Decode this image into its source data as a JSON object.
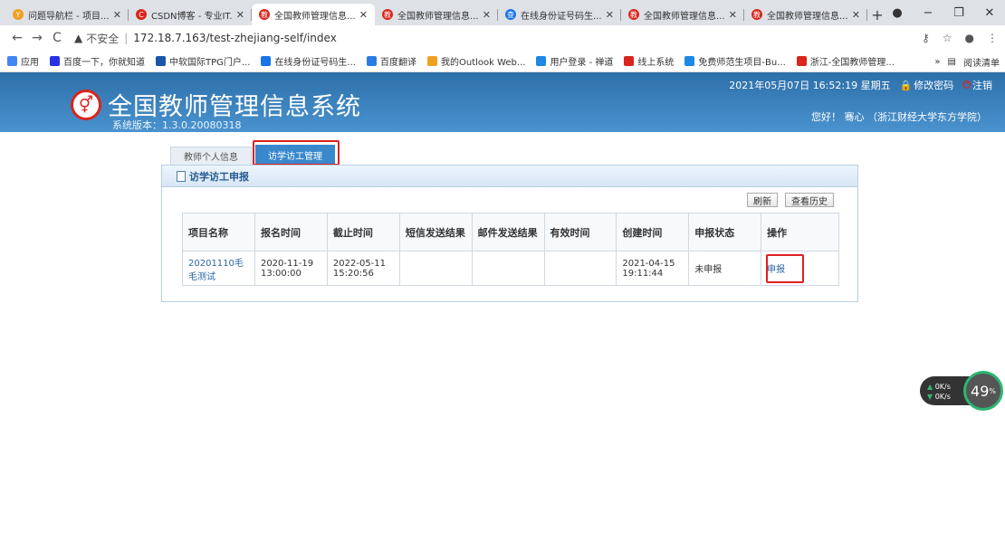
{
  "browser": {
    "tabs": [
      {
        "label": "问题导航栏 - 项目...",
        "icon_color": "#f0a020",
        "icon_char": "Y",
        "active": false
      },
      {
        "label": "CSDN博客 - 专业IT...",
        "icon_color": "#d9251c",
        "icon_char": "C",
        "active": false
      },
      {
        "label": "全国教师管理信息...",
        "icon_color": "#d9251c",
        "icon_char": "教",
        "active": true
      },
      {
        "label": "全国教师管理信息...",
        "icon_color": "#d9251c",
        "icon_char": "教",
        "active": false
      },
      {
        "label": "在线身份证号码生...",
        "icon_color": "#1a73e8",
        "icon_char": "查",
        "active": false
      },
      {
        "label": "全国教师管理信息...",
        "icon_color": "#d9251c",
        "icon_char": "教",
        "active": false
      },
      {
        "label": "全国教师管理信息...",
        "icon_color": "#d9251c",
        "icon_char": "教",
        "active": false
      }
    ],
    "new_tab_label": "+",
    "address": {
      "security_label": "不安全",
      "url": "172.18.7.163/test-zhejiang-self/index"
    },
    "bookmarks": [
      {
        "label": "应用",
        "icon_color": "#4285f4"
      },
      {
        "label": "百度一下，你就知道",
        "icon_color": "#2932e1"
      },
      {
        "label": "中软国际TPG门户...",
        "icon_color": "#1a56a8"
      },
      {
        "label": "在线身份证号码生...",
        "icon_color": "#1a73e8"
      },
      {
        "label": "百度翻译",
        "icon_color": "#2c7be5"
      },
      {
        "label": "我的Outlook Web...",
        "icon_color": "#f0a020"
      },
      {
        "label": "用户登录 - 禅道",
        "icon_color": "#1e88e5"
      },
      {
        "label": "线上系统",
        "icon_color": "#d9251c"
      },
      {
        "label": "免费师范生项目-Bu...",
        "icon_color": "#1e88e5"
      },
      {
        "label": "浙江-全国教师管理...",
        "icon_color": "#d9251c"
      }
    ],
    "bookmarks_more": "»",
    "reading_list": "阅读清单"
  },
  "header": {
    "title": "全国教师管理信息系统",
    "version": "系统版本：1.3.0.20080318",
    "datetime": "2021年05月07日 16:52:19 星期五",
    "change_password": "修改密码",
    "logout": "注销",
    "greeting": "您好！ 骞心 （浙江财经大学东方学院）"
  },
  "page_tabs": [
    {
      "label": "教师个人信息",
      "active": false
    },
    {
      "label": "访学访工管理",
      "active": true
    }
  ],
  "panel": {
    "title": "访学访工申报",
    "refresh_label": "刷新",
    "history_label": "查看历史"
  },
  "table": {
    "headers": [
      "项目名称",
      "报名时间",
      "截止时间",
      "短信发送结果",
      "邮件发送结果",
      "有效时间",
      "创建时间",
      "申报状态",
      "操作"
    ],
    "rows": [
      {
        "name": "20201110毛毛测试",
        "signup_time": "2020-11-19 13:00:00",
        "deadline": "2022-05-11 15:20:56",
        "sms_result": "",
        "email_result": "",
        "valid_time": "",
        "created_time": "2021-04-15 19:11:44",
        "status": "未申报",
        "action": "申报"
      }
    ]
  },
  "speed_widget": {
    "up": "0K/s",
    "down": "0K/s",
    "percent": "49"
  },
  "colors": {
    "header_bg": "#3a82c0",
    "highlight": "#e02020",
    "link": "#2966a6"
  }
}
